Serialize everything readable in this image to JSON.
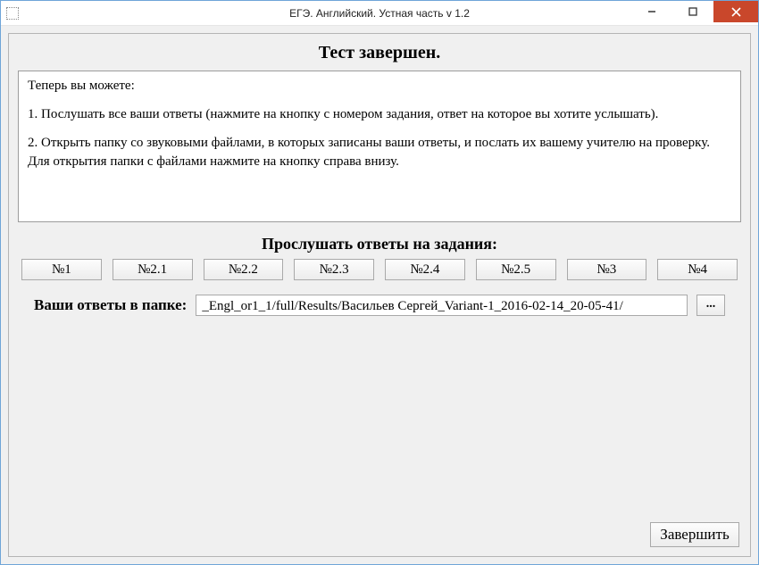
{
  "titlebar": {
    "title": "ЕГЭ. Английский. Устная часть v 1.2",
    "minimize": "–",
    "maximize": "□",
    "close": "×"
  },
  "main": {
    "heading": "Тест завершен.",
    "info": {
      "p1": "Теперь вы можете:",
      "p2": "1. Послушать все ваши ответы (нажмите на кнопку с номером задания, ответ на которое вы хотите услышать).",
      "p3": "2. Открыть папку со звуковыми файлами, в которых записаны ваши ответы, и послать их вашему учителю на проверку. Для открытия папки с файлами нажмите на кнопку справа внизу."
    },
    "listen_label": "Прослушать ответы на задания:",
    "tasks": [
      "№1",
      "№2.1",
      "№2.2",
      "№2.3",
      "№2.4",
      "№2.5",
      "№3",
      "№4"
    ],
    "folder_label": "Ваши ответы в папке:",
    "folder_path": "_Engl_or1_1/full/Results/Васильев Сергей_Variant-1_2016-02-14_20-05-41/",
    "browse_label": "...",
    "finish_label": "Завершить"
  }
}
